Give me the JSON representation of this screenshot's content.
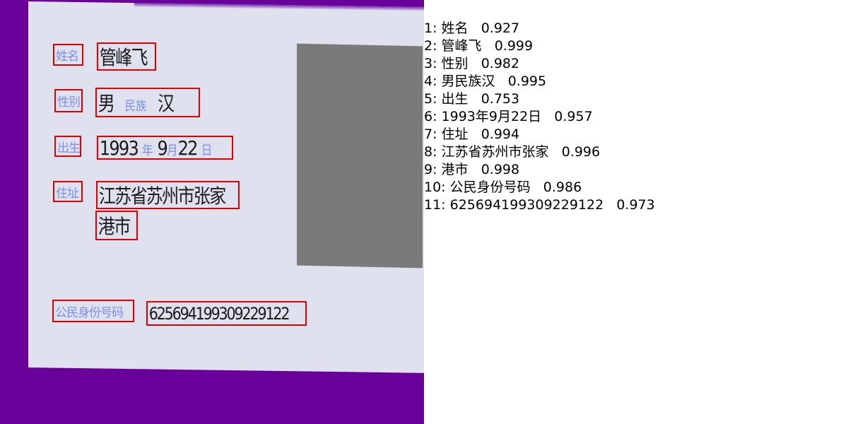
{
  "image": {
    "labels": {
      "name": "姓名",
      "gender": "性别",
      "birth": "出生",
      "address": "住址",
      "id_number": "公民身份号码"
    },
    "values": {
      "name": "管峰飞",
      "gender": "男",
      "ethnicity_label": "民族",
      "ethnicity": "汉",
      "birth_year": "1993",
      "birth_year_unit": "年",
      "birth_month": "9",
      "birth_month_unit": "月",
      "birth_day": "22",
      "birth_day_unit": "日",
      "address_line1": "江苏省苏州市张家",
      "address_line2": "港市",
      "id_number": "625694199309229122"
    }
  },
  "results": [
    {
      "index": "1:",
      "text": "姓名",
      "score": "0.927"
    },
    {
      "index": "2:",
      "text": "管峰飞",
      "score": "0.999"
    },
    {
      "index": "3:",
      "text": "性别",
      "score": "0.982"
    },
    {
      "index": "4:",
      "text": "男民族汉",
      "score": "0.995"
    },
    {
      "index": "5:",
      "text": "出生",
      "score": "0.753"
    },
    {
      "index": "6:",
      "text": "1993年9月22日",
      "score": "0.957"
    },
    {
      "index": "7:",
      "text": "住址",
      "score": "0.994"
    },
    {
      "index": "8:",
      "text": "江苏省苏州市张家",
      "score": "0.996"
    },
    {
      "index": "9:",
      "text": "港市",
      "score": "0.998"
    },
    {
      "index": "10:",
      "text": "公民身份号码",
      "score": "0.986"
    },
    {
      "index": "11:",
      "text": "625694199309229122",
      "score": "0.973"
    }
  ]
}
